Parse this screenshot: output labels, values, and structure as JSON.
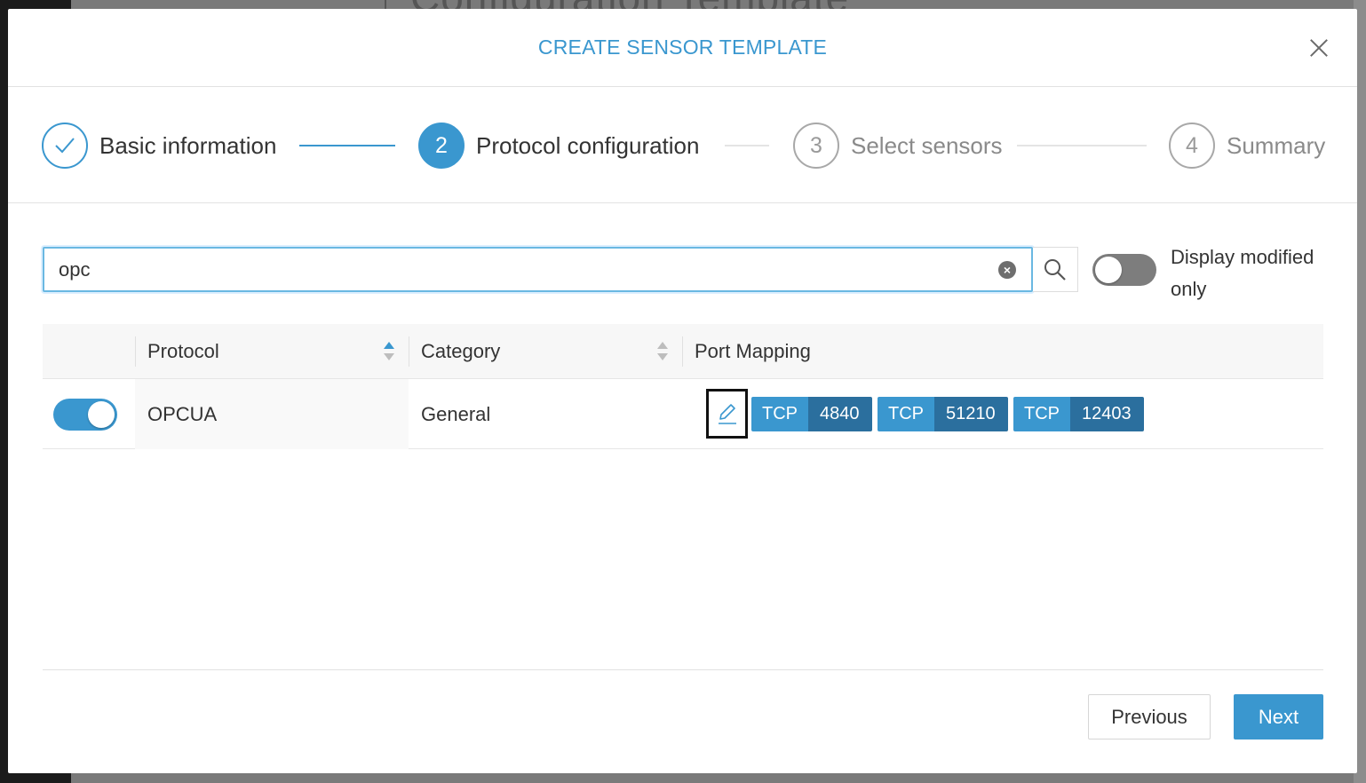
{
  "background": {
    "title": "Configuration Template"
  },
  "modal": {
    "title": "CREATE SENSOR TEMPLATE",
    "close_icon": "close-icon"
  },
  "stepper": {
    "steps": [
      {
        "number": "1",
        "label": "Basic information",
        "state": "completed",
        "icon": "checkmark-icon"
      },
      {
        "number": "2",
        "label": "Protocol configuration",
        "state": "active"
      },
      {
        "number": "3",
        "label": "Select sensors",
        "state": "pending"
      },
      {
        "number": "4",
        "label": "Summary",
        "state": "pending"
      }
    ]
  },
  "search": {
    "value": "opc",
    "placeholder": "",
    "clear_icon": "clear-icon",
    "search_icon": "search-icon"
  },
  "filter": {
    "display_modified_label": "Display modified only",
    "display_modified_on": false
  },
  "table": {
    "columns": [
      "Protocol",
      "Category",
      "Port Mapping"
    ],
    "sort": {
      "column": "Protocol",
      "direction": "asc"
    },
    "rows": [
      {
        "enabled": true,
        "protocol": "OPCUA",
        "category": "General",
        "ports": [
          {
            "proto": "TCP",
            "port": "4840"
          },
          {
            "proto": "TCP",
            "port": "51210"
          },
          {
            "proto": "TCP",
            "port": "12403"
          }
        ]
      }
    ]
  },
  "footer": {
    "previous_label": "Previous",
    "next_label": "Next"
  },
  "colors": {
    "accent": "#3a97cf",
    "port_number_bg": "#2b6f9e",
    "toggle_off": "#7d7d7d"
  }
}
